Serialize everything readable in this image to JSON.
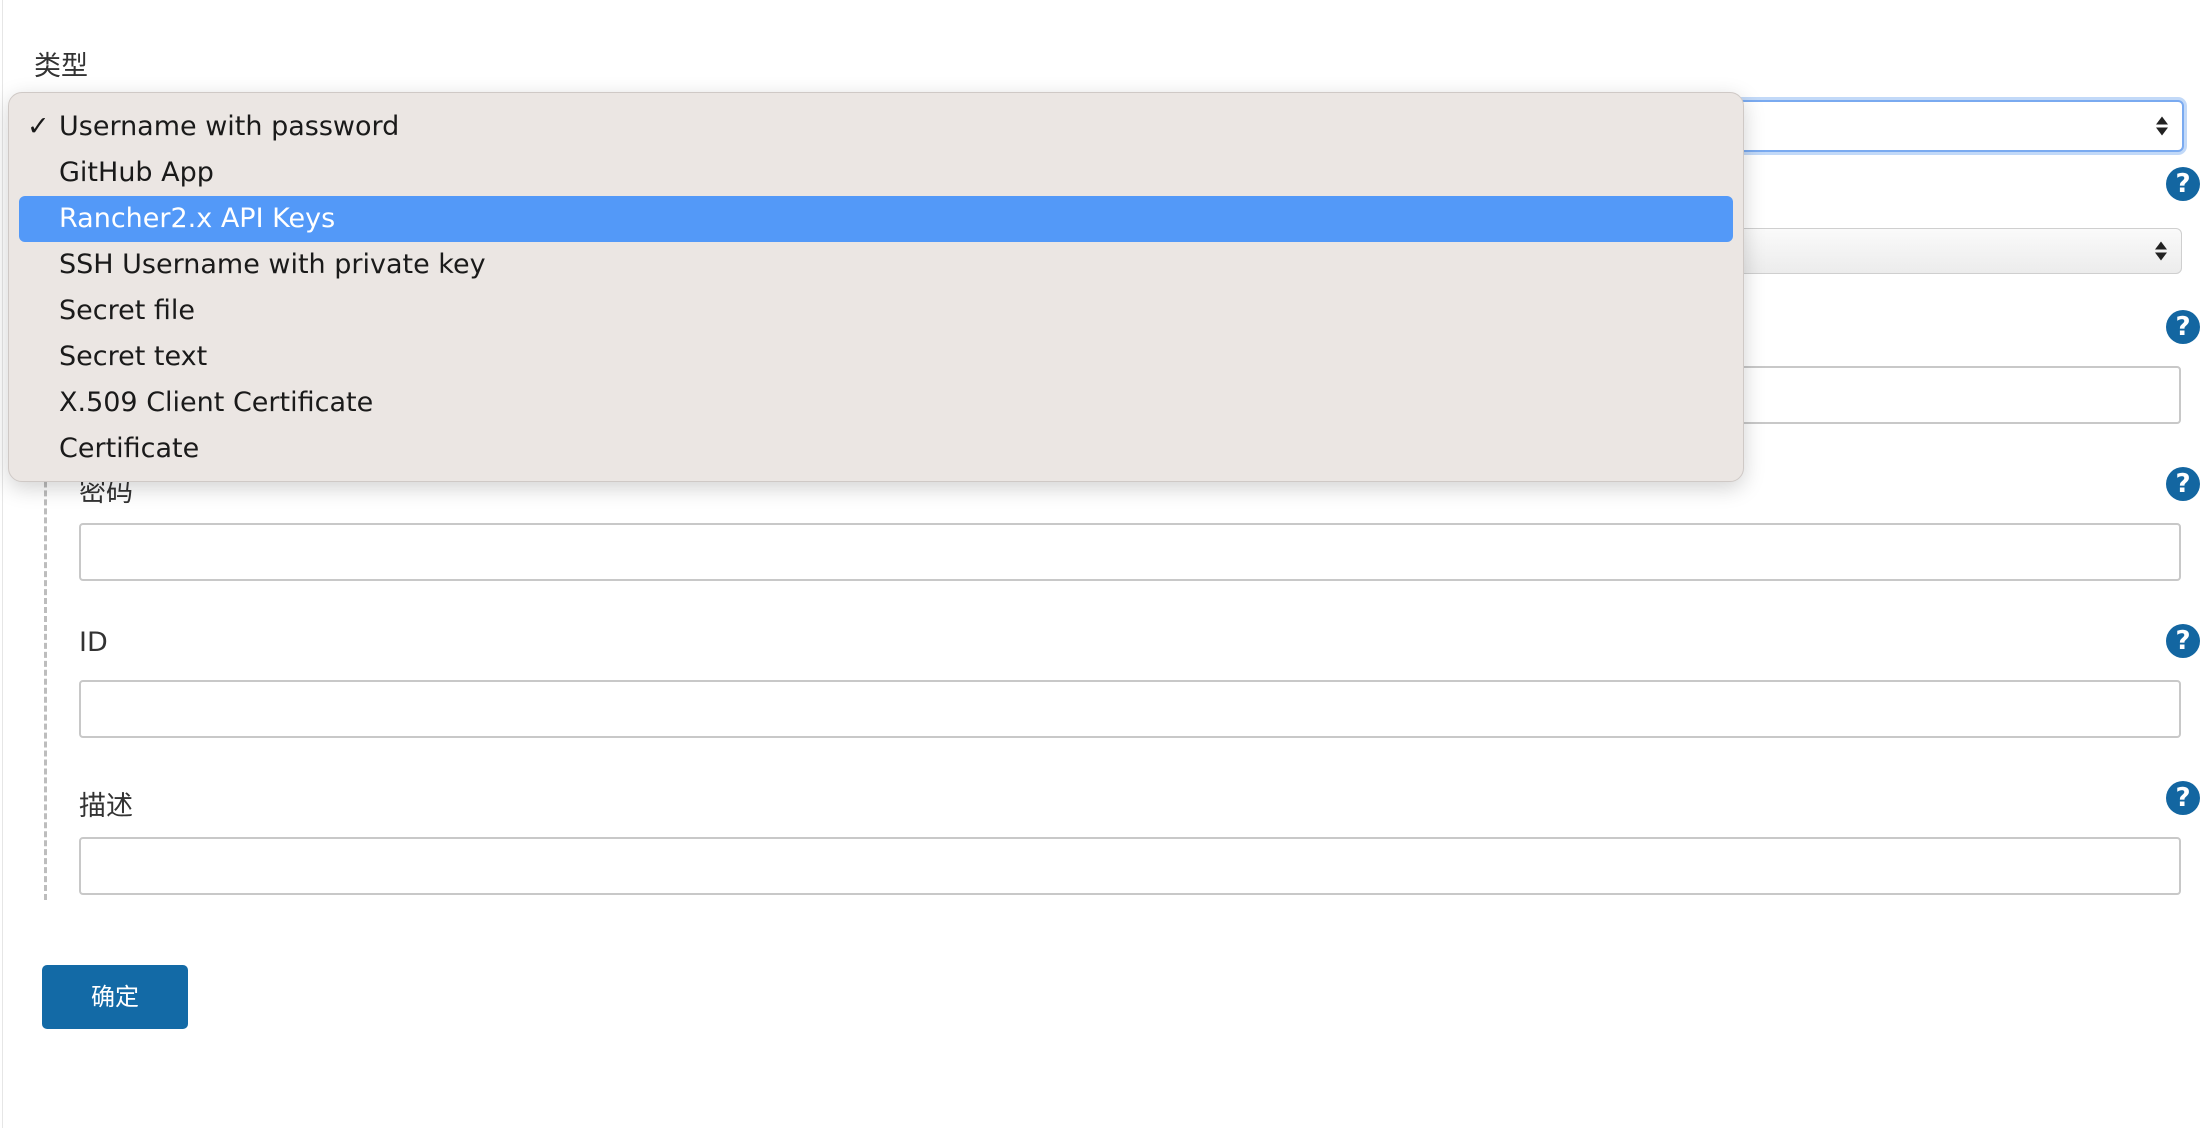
{
  "form": {
    "type_label": "类型",
    "password_label": "密码",
    "id_label": "ID",
    "description_label": "描述",
    "submit_label": "确定",
    "help_glyph": "?"
  },
  "dropdown": {
    "selected_index": 0,
    "highlighted_index": 2,
    "check_glyph": "✓",
    "options": [
      "Username with password",
      "GitHub App",
      "Rancher2.x API Keys",
      "SSH Username with private key",
      "Secret file",
      "Secret text",
      "X.509 Client Certificate",
      "Certificate"
    ]
  },
  "colors": {
    "accent": "#136aa6",
    "help_icon": "#1366a1",
    "highlight": "#5399f8",
    "menu_bg": "#ebe6e3"
  },
  "icons": {
    "help": "help-icon",
    "check": "checkmark-icon",
    "select_arrows": "select-arrows-icon"
  }
}
